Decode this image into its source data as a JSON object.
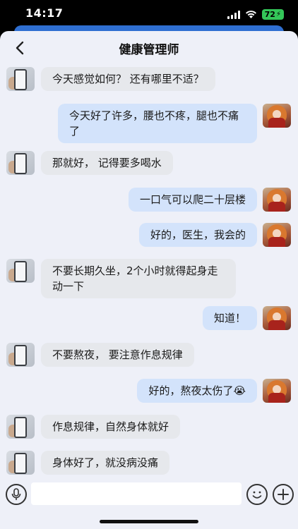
{
  "status": {
    "time": "14:17",
    "battery": "72"
  },
  "header": {
    "title": "健康管理师",
    "back_icon": "chevron-left-icon"
  },
  "messages": [
    {
      "side": "left",
      "text": "今天感觉如何？ 还有哪里不适？"
    },
    {
      "side": "right",
      "text": "今天好了许多，腰也不疼，腿也不痛了"
    },
    {
      "side": "left",
      "text": "那就好， 记得要多喝水"
    },
    {
      "side": "right",
      "text": "一口气可以爬二十层楼"
    },
    {
      "side": "right",
      "text": "好的，医生，我会的"
    },
    {
      "side": "left",
      "text": "不要长期久坐，2个小时就得起身走动一下"
    },
    {
      "side": "right",
      "text": "知道！"
    },
    {
      "side": "left",
      "text": "不要熬夜， 要注意作息规律"
    },
    {
      "side": "right",
      "text": "好的，熬夜太伤了😭"
    },
    {
      "side": "left",
      "text": "作息规律，自然身体就好"
    },
    {
      "side": "left",
      "text": "身体好了，就没病没痛"
    }
  ],
  "input": {
    "placeholder": "",
    "value": ""
  },
  "icons": {
    "voice": "microphone-icon",
    "emoji": "smiley-icon",
    "add": "plus-icon"
  }
}
